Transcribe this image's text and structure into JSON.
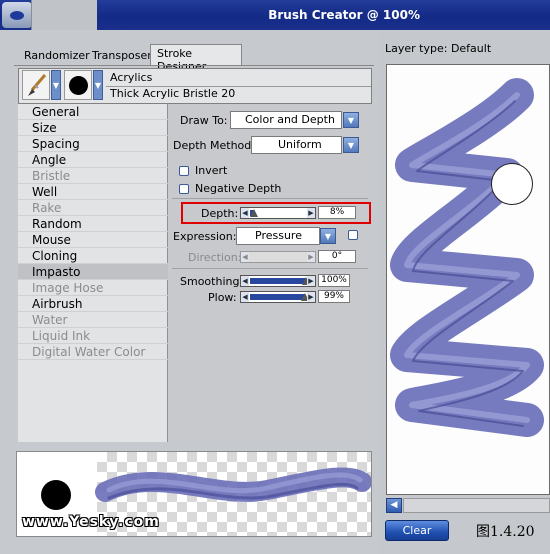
{
  "window": {
    "title": "Brush Creator @ 100%"
  },
  "tabs": [
    {
      "label": "Randomizer"
    },
    {
      "label": "Transposer"
    },
    {
      "label": "Stroke Designer"
    }
  ],
  "brush": {
    "category": "Acrylics",
    "variant": "Thick Acrylic Bristle 20"
  },
  "categories": [
    {
      "label": "General",
      "enabled": true
    },
    {
      "label": "Size",
      "enabled": true
    },
    {
      "label": "Spacing",
      "enabled": true
    },
    {
      "label": "Angle",
      "enabled": true
    },
    {
      "label": "Bristle",
      "enabled": false
    },
    {
      "label": "Well",
      "enabled": true
    },
    {
      "label": "Rake",
      "enabled": false
    },
    {
      "label": "Random",
      "enabled": true
    },
    {
      "label": "Mouse",
      "enabled": true
    },
    {
      "label": "Cloning",
      "enabled": true
    },
    {
      "label": "Impasto",
      "enabled": true,
      "selected": true
    },
    {
      "label": "Image Hose",
      "enabled": false
    },
    {
      "label": "Airbrush",
      "enabled": true
    },
    {
      "label": "Water",
      "enabled": false
    },
    {
      "label": "Liquid Ink",
      "enabled": false
    },
    {
      "label": "Digital Water Color",
      "enabled": false
    }
  ],
  "impasto": {
    "draw_to_label": "Draw To:",
    "draw_to_value": "Color and Depth",
    "depth_method_label": "Depth Method:",
    "depth_method_value": "Uniform",
    "invert_label": "Invert",
    "invert_checked": false,
    "negative_depth_label": "Negative Depth",
    "negative_depth_checked": false,
    "depth_label": "Depth:",
    "depth_value": "8%",
    "depth_fraction": 0.08,
    "expression_label": "Expression:",
    "expression_value": "Pressure",
    "direction_label": "Direction:",
    "direction_value": "0°",
    "smoothing_label": "Smoothing:",
    "smoothing_value": "100%",
    "smoothing_fraction": 1.0,
    "plow_label": "Plow:",
    "plow_value": "99%",
    "plow_fraction": 0.99
  },
  "right_panel": {
    "layer_type": "Layer type: Default",
    "clear_label": "Clear"
  },
  "watermark": "www.Yesky.com",
  "figure_label": "图1.4.20",
  "colors": {
    "title_bar": "#1a3290",
    "stroke": "#6a6fb8",
    "highlight": "#e00000",
    "accent": "#27489e"
  },
  "icons": [
    "brush-icon",
    "dab-circle-icon",
    "dropdown-arrow-icon",
    "scroll-left-icon"
  ]
}
